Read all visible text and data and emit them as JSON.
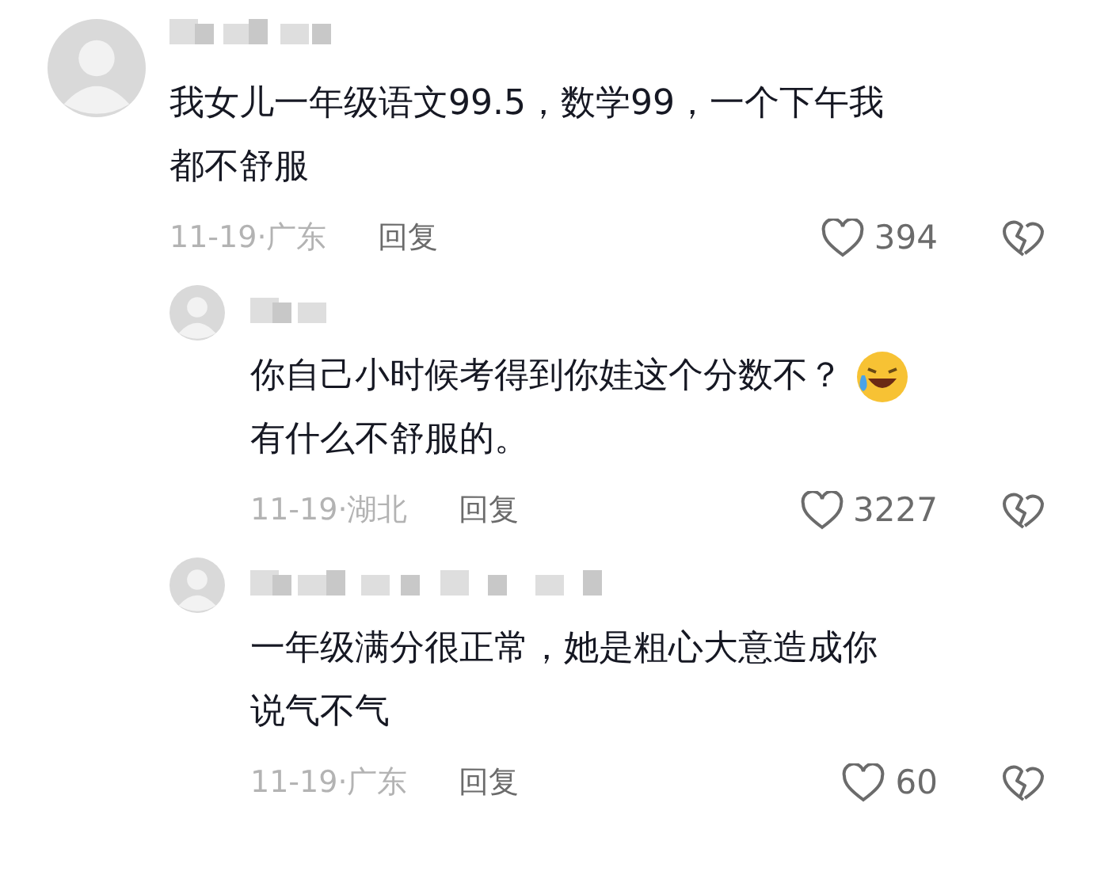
{
  "comment": {
    "text": [
      {
        "kind": "text",
        "text": "我女儿一年级语文99.5，数学99，一个下午我"
      },
      {
        "kind": "break"
      },
      {
        "kind": "text",
        "text": "都不舒服"
      }
    ],
    "date_location": "11-19·广东",
    "reply_label": "回复",
    "likes": "394"
  },
  "replies": [
    {
      "text": [
        {
          "kind": "text",
          "text": "你自己小时候考得到你娃这个分数不？"
        },
        {
          "kind": "emoji"
        },
        {
          "kind": "break"
        },
        {
          "kind": "text",
          "text": "有什么不舒服的。"
        }
      ],
      "date_location": "11-19·湖北",
      "reply_label": "回复",
      "likes": "3227"
    },
    {
      "text": [
        {
          "kind": "text",
          "text": "一年级满分很正常，她是粗心大意造成你"
        },
        {
          "kind": "break"
        },
        {
          "kind": "text",
          "text": "说气不气"
        }
      ],
      "date_location": "11-19·广东",
      "reply_label": "回复",
      "likes": "60"
    }
  ]
}
